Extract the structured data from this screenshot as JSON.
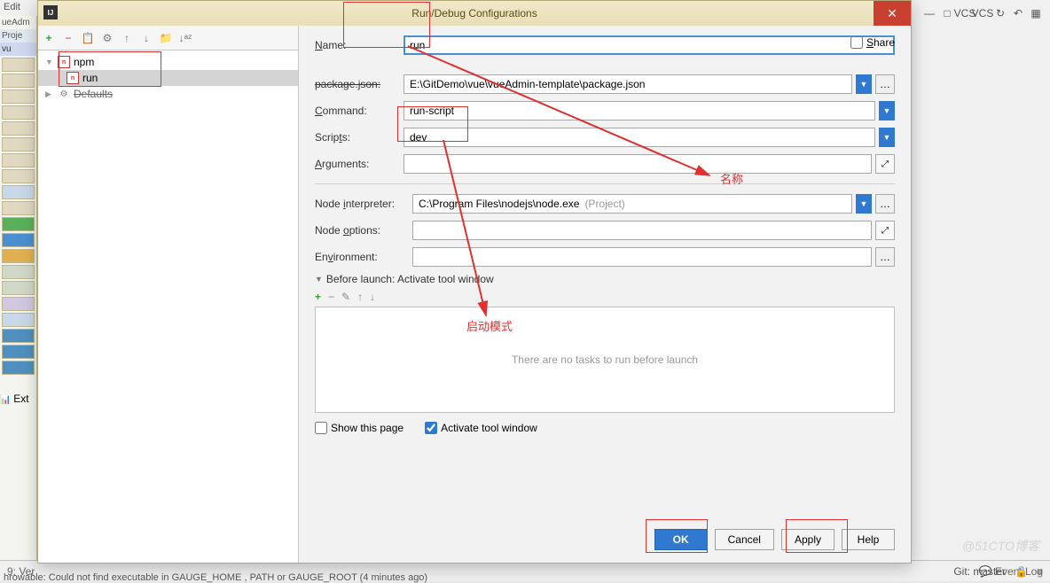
{
  "ide": {
    "menu_edit": "Edit",
    "project_label": "Proje",
    "admin_label": "ueAdm",
    "vu_label": "vu",
    "ext_label": "Ext",
    "status_left": "9: Ver",
    "throwable": "hrowable: Could not find executable in  GAUGE_HOME ,  PATH  or  GAUGE_ROOT  (4 minutes ago)",
    "git": "Git: master",
    "event_log": "Event Log",
    "vcs1": "VCS",
    "vcs2": "VCS"
  },
  "dialog": {
    "title": "Run/Debug Configurations",
    "ij": "IJ",
    "share": "Share"
  },
  "tree": {
    "npm": "npm",
    "run": "run",
    "defaults": "Defaults"
  },
  "form": {
    "name_label": "Name:",
    "name_value": "run",
    "pkg_label": "package.json:",
    "pkg_value": "E:\\GitDemo\\vue\\vueAdmin-template\\package.json",
    "cmd_label": "Command:",
    "cmd_value": "run-script",
    "scripts_label": "Scripts:",
    "scripts_value": "dev",
    "args_label": "Arguments:",
    "args_value": "",
    "node_label": "Node interpreter:",
    "node_value": "C:\\Program Files\\nodejs\\node.exe",
    "node_hint": "(Project)",
    "nodeopt_label": "Node options:",
    "nodeopt_value": "",
    "env_label": "Environment:",
    "env_value": ""
  },
  "before": {
    "header": "Before launch: Activate tool window",
    "empty": "There are no tasks to run before launch",
    "show_page": "Show this page",
    "activate": "Activate tool window"
  },
  "buttons": {
    "ok": "OK",
    "cancel": "Cancel",
    "apply": "Apply",
    "help": "Help"
  },
  "annotations": {
    "name_cn": "名称",
    "mode_cn": "启动模式"
  },
  "watermark": "@51CTO博客"
}
